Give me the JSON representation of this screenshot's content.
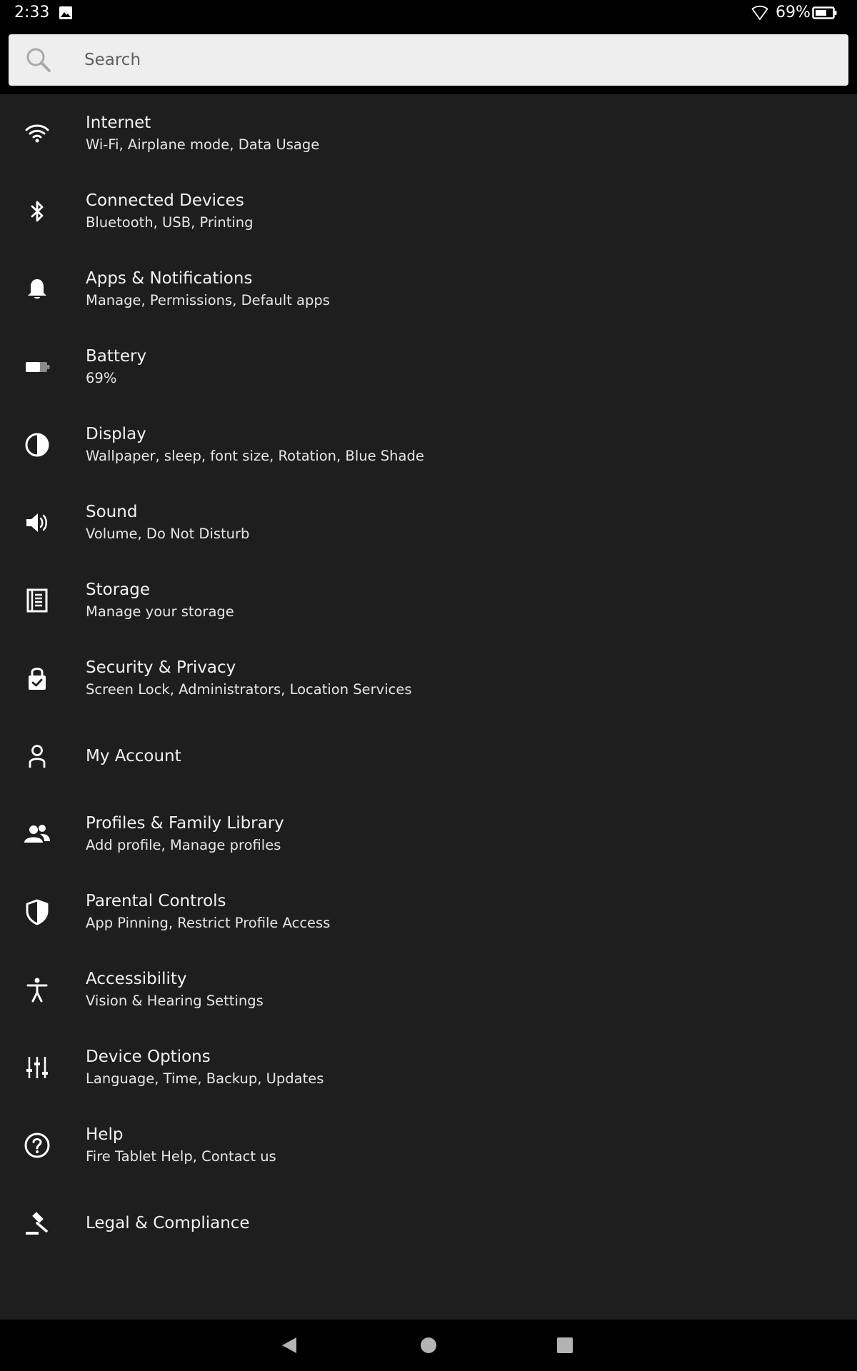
{
  "status_bar": {
    "time": "2:33",
    "battery_percent": "69%"
  },
  "search": {
    "placeholder": "Search",
    "value": ""
  },
  "settings": [
    {
      "id": "internet",
      "icon": "wifi-icon",
      "title": "Internet",
      "subtitle": "Wi-Fi, Airplane mode, Data Usage"
    },
    {
      "id": "connected-devices",
      "icon": "bluetooth-icon",
      "title": "Connected Devices",
      "subtitle": "Bluetooth, USB, Printing"
    },
    {
      "id": "apps-notifications",
      "icon": "bell-icon",
      "title": "Apps & Notifications",
      "subtitle": "Manage, Permissions, Default apps"
    },
    {
      "id": "battery",
      "icon": "battery-icon",
      "title": "Battery",
      "subtitle": "69%"
    },
    {
      "id": "display",
      "icon": "contrast-icon",
      "title": "Display",
      "subtitle": "Wallpaper, sleep, font size, Rotation, Blue Shade"
    },
    {
      "id": "sound",
      "icon": "speaker-icon",
      "title": "Sound",
      "subtitle": "Volume, Do Not Disturb"
    },
    {
      "id": "storage",
      "icon": "storage-icon",
      "title": "Storage",
      "subtitle": "Manage your storage"
    },
    {
      "id": "security-privacy",
      "icon": "lock-check-icon",
      "title": "Security & Privacy",
      "subtitle": "Screen Lock, Administrators, Location Services"
    },
    {
      "id": "my-account",
      "icon": "person-icon",
      "title": "My Account",
      "subtitle": ""
    },
    {
      "id": "profiles-family",
      "icon": "people-icon",
      "title": "Profiles & Family Library",
      "subtitle": "Add profile, Manage profiles"
    },
    {
      "id": "parental-controls",
      "icon": "shield-icon",
      "title": "Parental Controls",
      "subtitle": "App Pinning, Restrict Profile Access"
    },
    {
      "id": "accessibility",
      "icon": "accessibility-icon",
      "title": "Accessibility",
      "subtitle": "Vision & Hearing Settings"
    },
    {
      "id": "device-options",
      "icon": "sliders-icon",
      "title": "Device Options",
      "subtitle": "Language, Time, Backup, Updates"
    },
    {
      "id": "help",
      "icon": "help-icon",
      "title": "Help",
      "subtitle": "Fire Tablet Help, Contact us"
    },
    {
      "id": "legal",
      "icon": "gavel-icon",
      "title": "Legal & Compliance",
      "subtitle": ""
    }
  ],
  "colors": {
    "background": "#1e1e1e",
    "status_bar": "#000000",
    "search_bar": "#eeeeee",
    "text_primary": "#f2f2f2"
  }
}
